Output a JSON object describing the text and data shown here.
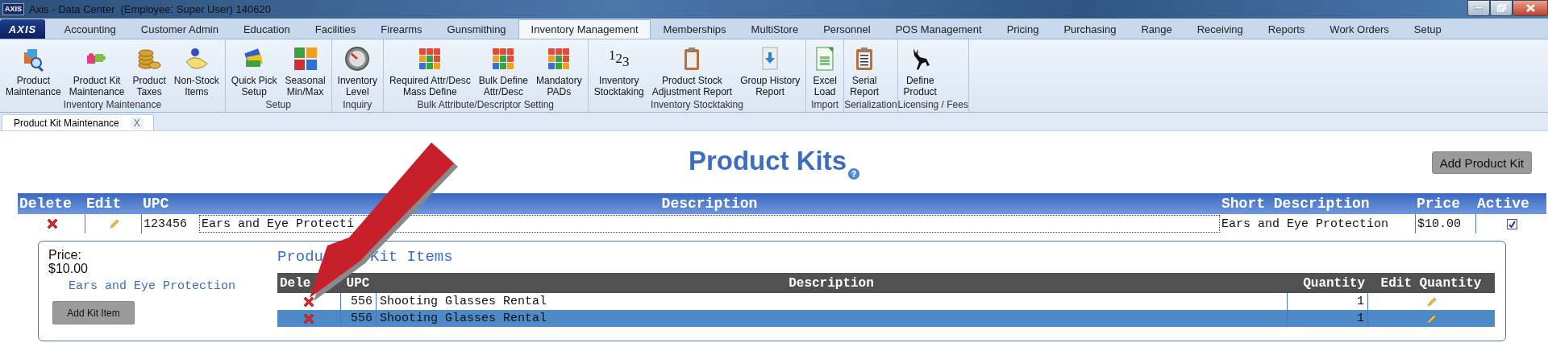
{
  "window": {
    "app_icon_text": "AXIS",
    "title": "Axis - Data Center  (Employee: Super User) 140620"
  },
  "ribbon_tabs": {
    "logo": "AXIS",
    "tabs": [
      {
        "label": "Accounting",
        "selected": false
      },
      {
        "label": "Customer Admin",
        "selected": false
      },
      {
        "label": "Education",
        "selected": false
      },
      {
        "label": "Facilities",
        "selected": false
      },
      {
        "label": "Firearms",
        "selected": false
      },
      {
        "label": "Gunsmithing",
        "selected": false
      },
      {
        "label": "Inventory Management",
        "selected": true
      },
      {
        "label": "Memberships",
        "selected": false
      },
      {
        "label": "MultiStore",
        "selected": false
      },
      {
        "label": "Personnel",
        "selected": false
      },
      {
        "label": "POS Management",
        "selected": false
      },
      {
        "label": "Pricing",
        "selected": false
      },
      {
        "label": "Purchasing",
        "selected": false
      },
      {
        "label": "Range",
        "selected": false
      },
      {
        "label": "Receiving",
        "selected": false
      },
      {
        "label": "Reports",
        "selected": false
      },
      {
        "label": "Work Orders",
        "selected": false
      },
      {
        "label": "Setup",
        "selected": false
      }
    ]
  },
  "ribbon_groups": [
    {
      "label": "Inventory Maintenance",
      "buttons": [
        {
          "lines": [
            "Product",
            "Maintenance"
          ]
        },
        {
          "lines": [
            "Product Kit",
            "Maintenance"
          ]
        },
        {
          "lines": [
            "Product",
            "Taxes"
          ]
        },
        {
          "lines": [
            "Non-Stock",
            "Items"
          ]
        }
      ]
    },
    {
      "label": "Setup",
      "buttons": [
        {
          "lines": [
            "Quick Pick",
            "Setup"
          ]
        },
        {
          "lines": [
            "Seasonal",
            "Min/Max"
          ]
        }
      ]
    },
    {
      "label": "Inquiry",
      "buttons": [
        {
          "lines": [
            "Inventory",
            "Level"
          ]
        }
      ]
    },
    {
      "label": "Bulk Attribute/Descriptor Setting",
      "buttons": [
        {
          "lines": [
            "Required Attr/Desc",
            "Mass Define"
          ]
        },
        {
          "lines": [
            "Bulk Define",
            "Attr/Desc"
          ]
        },
        {
          "lines": [
            "Mandatory",
            "PADs"
          ]
        }
      ]
    },
    {
      "label": "Inventory Stocktaking",
      "buttons": [
        {
          "lines": [
            "Inventory",
            "Stocktaking"
          ],
          "glyph": [
            "1",
            "2",
            "3"
          ]
        },
        {
          "lines": [
            "Product Stock",
            "Adjustment Report"
          ]
        },
        {
          "lines": [
            "Group History",
            "Report"
          ]
        }
      ]
    },
    {
      "label": "Import",
      "buttons": [
        {
          "lines": [
            "Excel",
            "Load"
          ]
        }
      ]
    },
    {
      "label": "Serialization",
      "buttons": [
        {
          "lines": [
            "Serial",
            "Report"
          ]
        }
      ]
    },
    {
      "label": "Licensing / Fees",
      "buttons": [
        {
          "lines": [
            "Define",
            "Product"
          ]
        }
      ]
    }
  ],
  "document_tabs": [
    {
      "label": "Product Kit Maintenance",
      "close": "X",
      "selected": true
    }
  ],
  "page": {
    "title": "Product Kits",
    "help": "?",
    "add_button": "Add Product Kit"
  },
  "kits_table": {
    "columns": [
      "Delete",
      "Edit",
      "UPC",
      "Description",
      "Short Description",
      "Price",
      "Active"
    ],
    "rows": [
      {
        "upc": "123456",
        "description": "Ears and Eye Protecti",
        "short_description": "Ears and Eye Protection",
        "price": "$10.00",
        "active": true,
        "detail": {
          "price_label": "Price:",
          "price": "$10.00",
          "short_description": "Ears and Eye Protection",
          "add_button": "Add Kit Item",
          "items_title_parts": [
            "Produ",
            "Kit Items"
          ],
          "items_columns": [
            "Dele",
            "UPC",
            "Description",
            "Quantity",
            "Edit Quantity"
          ],
          "items": [
            {
              "upc": "556",
              "description": "Shooting Glasses Rental",
              "quantity": "1",
              "selected": false
            },
            {
              "upc": "556",
              "description": "Shooting Glasses Rental",
              "quantity": "1",
              "selected": true
            }
          ]
        }
      }
    ]
  },
  "annotation": {
    "kind": "arrow"
  }
}
